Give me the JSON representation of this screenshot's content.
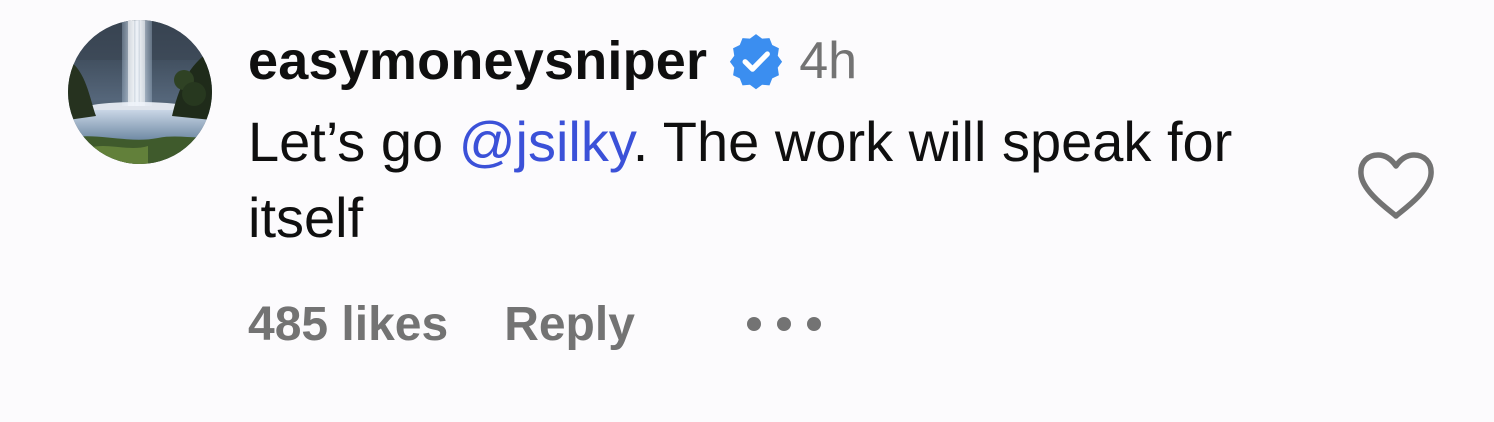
{
  "comment": {
    "username": "easymoneysniper",
    "verified": true,
    "timestamp": "4h",
    "text_before_mention": "Let’s go ",
    "mention": "@jsilky",
    "text_after_mention": ". The work will speak for itself",
    "likes_label": "485 likes",
    "reply_label": "Reply",
    "icons": {
      "verified": "verified-badge-icon",
      "like": "heart-outline-icon",
      "more": "more-options-icon"
    },
    "colors": {
      "mention": "#3b51d8",
      "verified_badge": "#3b8ef0",
      "secondary_text": "#737373"
    }
  }
}
